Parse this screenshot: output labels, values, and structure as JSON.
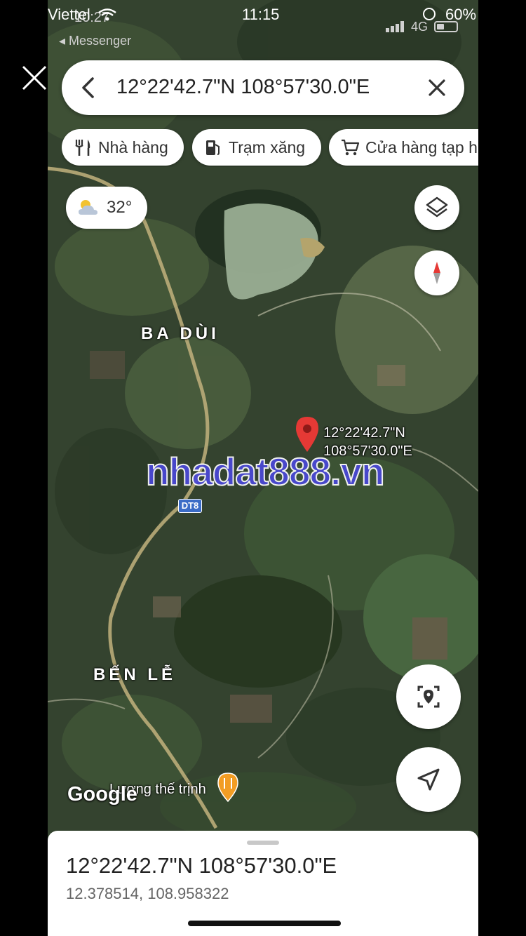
{
  "outer_status": {
    "carrier": "Viettel",
    "time": "11:15",
    "battery": "60%"
  },
  "inner_status": {
    "time": "10:27",
    "back_app": "◂ Messenger",
    "network": "4G"
  },
  "search": {
    "query": "12°22'42.7\"N 108°57'30.0\"E"
  },
  "chips": [
    {
      "label": "Nhà hàng",
      "icon": "restaurant-icon"
    },
    {
      "label": "Trạm xăng",
      "icon": "gas-station-icon"
    },
    {
      "label": "Cửa hàng tạp h",
      "icon": "shopping-cart-icon"
    }
  ],
  "weather": {
    "temperature": "32°",
    "icon": "partly-cloudy-icon"
  },
  "map": {
    "labels": [
      "BA DÙI",
      "BẾN LỄ"
    ],
    "road": "DT8",
    "poi": "Lương thế trịnh",
    "logo": "Google",
    "marker": {
      "lat": "12°22'42.7\"N",
      "lng": "108°57'30.0\"E",
      "color": "#e53935"
    }
  },
  "watermark": "nhadat888.vn",
  "sheet": {
    "title": "12°22'42.7\"N 108°57'30.0\"E",
    "decimal": "12.378514, 108.958322"
  },
  "colors": {
    "marker": "#e53935",
    "watermark": "#4a48d8",
    "road_badge": "#3b6cc7"
  }
}
